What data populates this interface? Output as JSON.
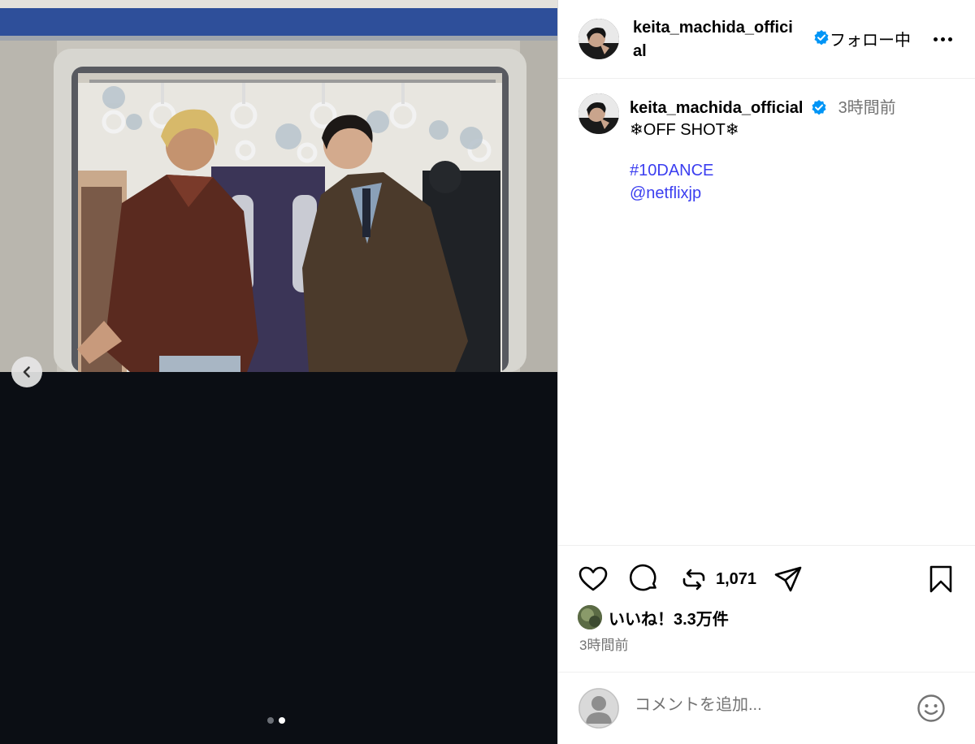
{
  "post": {
    "username": "keita_machida_official",
    "username_header_line1": "keita_machida_offici",
    "username_header_line2": "al",
    "follow_label": "フォロー中",
    "time_ago": "3時間前",
    "caption": "❄OFF SHOT❄",
    "hashtag": "#10DANCE",
    "mention": "@netflixjp",
    "repost_count": "1,071",
    "likes_label": "いいね！3.3万件",
    "post_time": "3時間前",
    "comment_placeholder": "コメントを追加..."
  },
  "carousel": {
    "total": 2,
    "current": 2
  },
  "icons": {
    "prev": "chevron-left-icon",
    "more": "more-icon",
    "verified": "verified-badge-icon",
    "like": "heart-icon",
    "comment": "comment-icon",
    "repost": "repost-icon",
    "share": "share-icon",
    "save": "bookmark-icon",
    "emoji": "emoji-icon"
  },
  "colors": {
    "link": "#3b3ef0",
    "verified": "#0095f6",
    "muted": "#737373",
    "media_bg": "#0b0e14"
  }
}
